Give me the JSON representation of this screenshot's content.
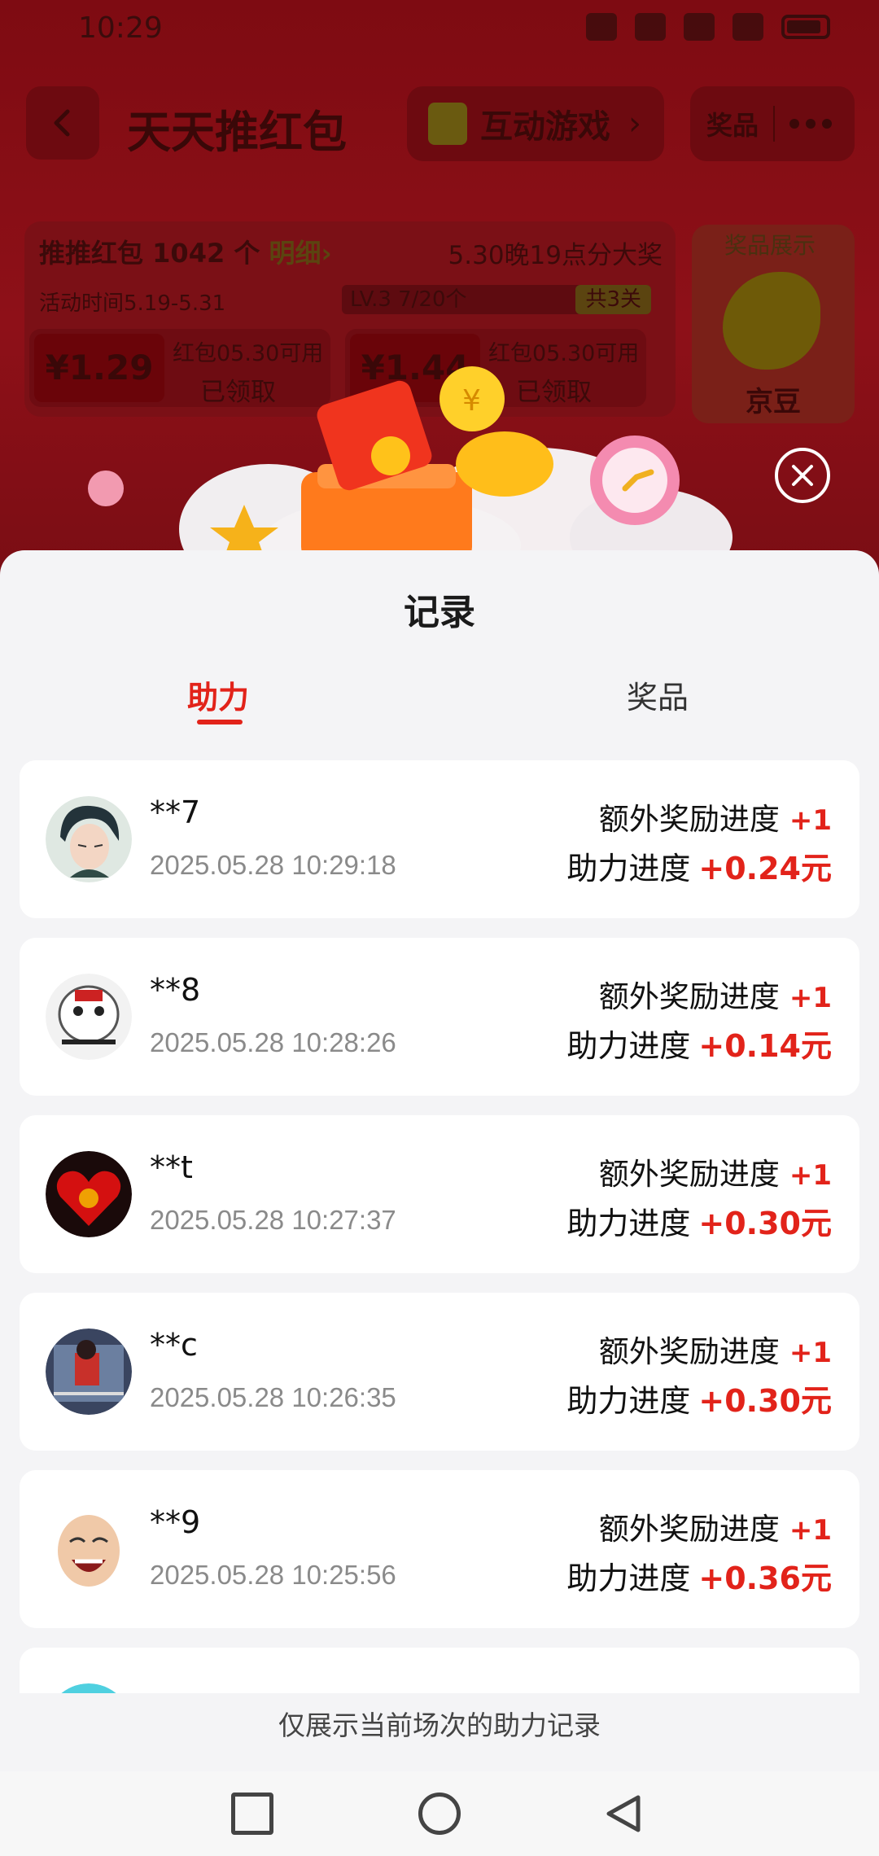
{
  "status_bar": {
    "time": "10:29"
  },
  "header": {
    "title": "天天推红包",
    "game_label": "互动游戏",
    "prize_label": "奖品"
  },
  "activity": {
    "count_prefix": "推推红包",
    "count_value": "1042",
    "count_unit": "个",
    "detail_link": "明细",
    "announce": "5.30晚19点分大奖",
    "period": "活动时间5.19-5.31",
    "level": "LV.3 7/20个",
    "level_tag": "共3关",
    "coupons": [
      {
        "amount": "¥1.29",
        "note": "红包05.30可用",
        "status": "已领取"
      },
      {
        "amount": "¥1.44",
        "note": "红包05.30可用",
        "status": "已领取"
      }
    ],
    "prize_show_title": "奖品展示",
    "prize_show_name": "京豆"
  },
  "sheet": {
    "title": "记录",
    "tabs": [
      {
        "label": "助力",
        "active": true
      },
      {
        "label": "奖品",
        "active": false
      }
    ],
    "records": [
      {
        "name": "**7",
        "time": "2025.05.28 10:29:18",
        "extra_label": "额外奖励进度",
        "extra_value": "+1",
        "help_label": "助力进度",
        "help_value": "+0.24元"
      },
      {
        "name": "**8",
        "time": "2025.05.28 10:28:26",
        "extra_label": "额外奖励进度",
        "extra_value": "+1",
        "help_label": "助力进度",
        "help_value": "+0.14元"
      },
      {
        "name": "**t",
        "time": "2025.05.28 10:27:37",
        "extra_label": "额外奖励进度",
        "extra_value": "+1",
        "help_label": "助力进度",
        "help_value": "+0.30元"
      },
      {
        "name": "**c",
        "time": "2025.05.28 10:26:35",
        "extra_label": "额外奖励进度",
        "extra_value": "+1",
        "help_label": "助力进度",
        "help_value": "+0.30元"
      },
      {
        "name": "**9",
        "time": "2025.05.28 10:25:56",
        "extra_label": "额外奖励进度",
        "extra_value": "+1",
        "help_label": "助力进度",
        "help_value": "+0.36元"
      }
    ],
    "footer_note": "仅展示当前场次的助力记录"
  },
  "colors": {
    "accent": "#e2231a",
    "sheet_bg": "#f4f4f6"
  }
}
